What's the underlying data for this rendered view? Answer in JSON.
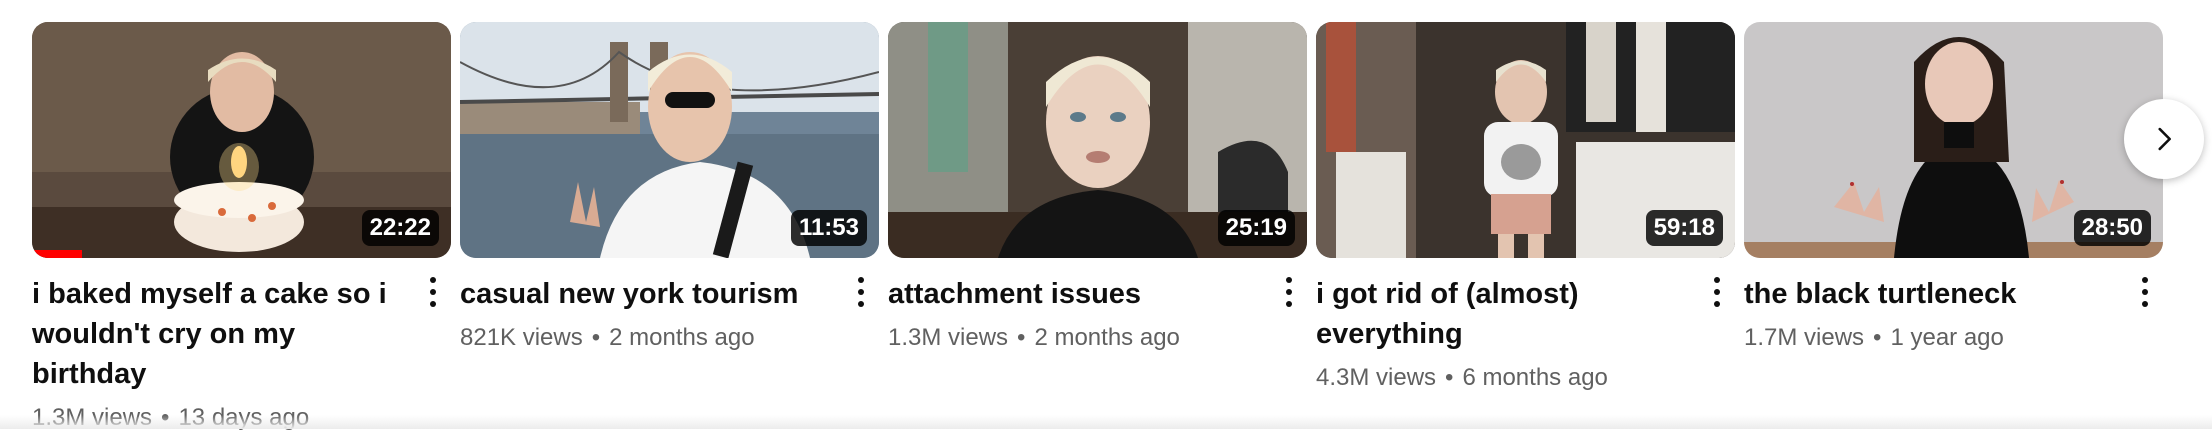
{
  "videos": [
    {
      "title": "i baked myself a cake so i wouldn't cry on my birthday",
      "duration": "22:22",
      "views": "1.3M views",
      "age": "13 days ago",
      "watched_fraction": 0.12
    },
    {
      "title": "casual new york tourism",
      "duration": "11:53",
      "views": "821K views",
      "age": "2 months ago"
    },
    {
      "title": "attachment issues",
      "duration": "25:19",
      "views": "1.3M views",
      "age": "2 months ago"
    },
    {
      "title": "i got rid of (almost) everything",
      "duration": "59:18",
      "views": "4.3M views",
      "age": "6 months ago"
    },
    {
      "title": "the black turtleneck",
      "duration": "28:50",
      "views": "1.7M views",
      "age": "1 year ago"
    }
  ],
  "separator": "•",
  "icons": {
    "next": "chevron-right-icon",
    "more": "more-vert-icon"
  },
  "colors": {
    "progress": "#ff0000",
    "duration_bg": "#000000",
    "meta_text": "#606060"
  }
}
